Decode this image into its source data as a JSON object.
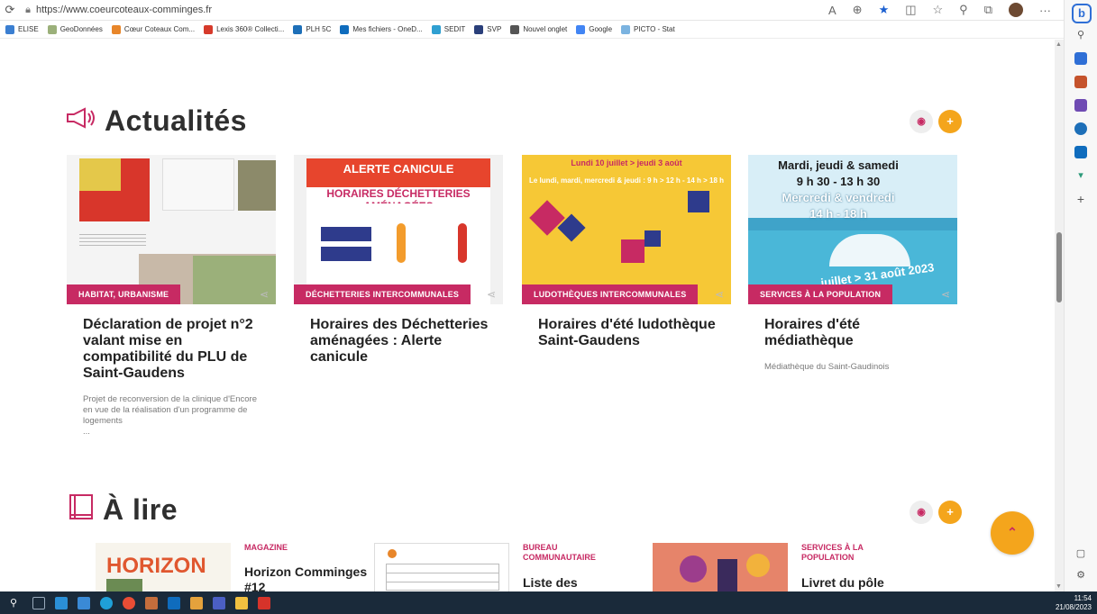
{
  "browser": {
    "url": "https://www.coeurcoteaux-comminges.fr",
    "bookmarks": [
      {
        "label": "ELISE",
        "color": "#3b7fd1"
      },
      {
        "label": "GeoDonnées",
        "color": "#9bb07a"
      },
      {
        "label": "Cœur Coteaux Com...",
        "color": "#e8862a"
      },
      {
        "label": "Lexis 360® Collecti...",
        "color": "#d63a2b"
      },
      {
        "label": "PLH 5C",
        "color": "#1d6fb8"
      },
      {
        "label": "Mes fichiers - OneD...",
        "color": "#0f6cbd"
      },
      {
        "label": "SEDIT",
        "color": "#2f9fd1"
      },
      {
        "label": "SVP",
        "color": "#2a3f7a"
      },
      {
        "label": "Nouvel onglet",
        "color": "#555555"
      },
      {
        "label": "Google",
        "color": "#4285f4"
      },
      {
        "label": "PICTO - Stat",
        "color": "#7bb3e0"
      }
    ]
  },
  "actualites": {
    "title": "Actualités",
    "icon": "megaphone-icon",
    "cards": [
      {
        "category": "HABITAT, URBANISME",
        "title": "Déclaration de projet n°2 valant mise en compatibilité du PLU de Saint-Gaudens",
        "desc": "Projet de reconversion de la clinique d'Encore en vue de la réalisation d'un programme de logements",
        "ellipsis": "..."
      },
      {
        "category": "DÉCHETTERIES INTERCOMMUNALES",
        "title": "Horaires des Déchetteries aménagées : Alerte canicule",
        "desc": "",
        "thumb": {
          "line1": "ALERTE CANICULE",
          "line2": "HORAIRES DÉCHETTERIES AMÉNAGÉES"
        }
      },
      {
        "category": "LUDOTHÈQUES INTERCOMMUNALES",
        "title": "Horaires d'été ludothèque Saint-Gaudens",
        "desc": "",
        "thumb": {
          "line1": "Lundi 10 juillet > jeudi 3 août",
          "line2": "Le lundi, mardi, mercredi & jeudi : 9 h > 12 h - 14 h > 18 h"
        }
      },
      {
        "category": "SERVICES À LA POPULATION",
        "title": "Horaires d'été médiathèque",
        "desc": "Médiathèque du Saint-Gaudinois",
        "thumb": {
          "line1": "Mardi, jeudi & samedi",
          "line2": "9 h 30 - 13 h 30",
          "line3": "Mercredi & vendredi",
          "line4": "14 h - 18 h",
          "line5": "juillet > 31 août 2023"
        }
      }
    ]
  },
  "alire": {
    "title": "À lire",
    "icon": "book-icon",
    "items": [
      {
        "category": "MAGAZINE",
        "title": "Horizon Comminges #12",
        "logo": "HORIZON"
      },
      {
        "category": "BUREAU COMMUNAUTAIRE",
        "title": "Liste des"
      },
      {
        "category": "SERVICES À LA POPULATION",
        "title": "Livret du pôle"
      }
    ]
  },
  "taskbar": {
    "time": "11:54",
    "date": "21/08/2023"
  },
  "colors": {
    "accent": "#c72a63",
    "orange": "#f4a51c"
  }
}
